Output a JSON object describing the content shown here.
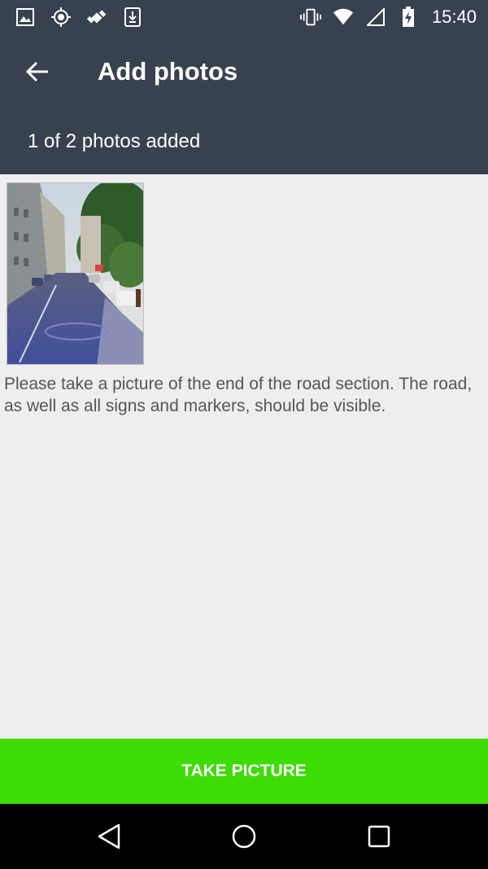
{
  "status_bar": {
    "time": "15:40",
    "left_icons": [
      "image-icon",
      "location-icon",
      "fake-gps-icon",
      "download-icon"
    ],
    "right_icons": [
      "vibrate-icon",
      "wifi-icon",
      "signal-icon",
      "battery-charging-icon"
    ]
  },
  "app_bar": {
    "title": "Add photos",
    "subtitle": "1 of 2 photos added"
  },
  "main": {
    "instructions": "Please take a picture of the end of the road section. The road, as well as all signs and markers, should be visible."
  },
  "actions": {
    "take_picture_label": "TAKE PICTURE"
  },
  "colors": {
    "app_bar": "#37424e",
    "background": "#eeeeee",
    "accent_button": "#3ddc04",
    "nav_bar": "#000000"
  }
}
